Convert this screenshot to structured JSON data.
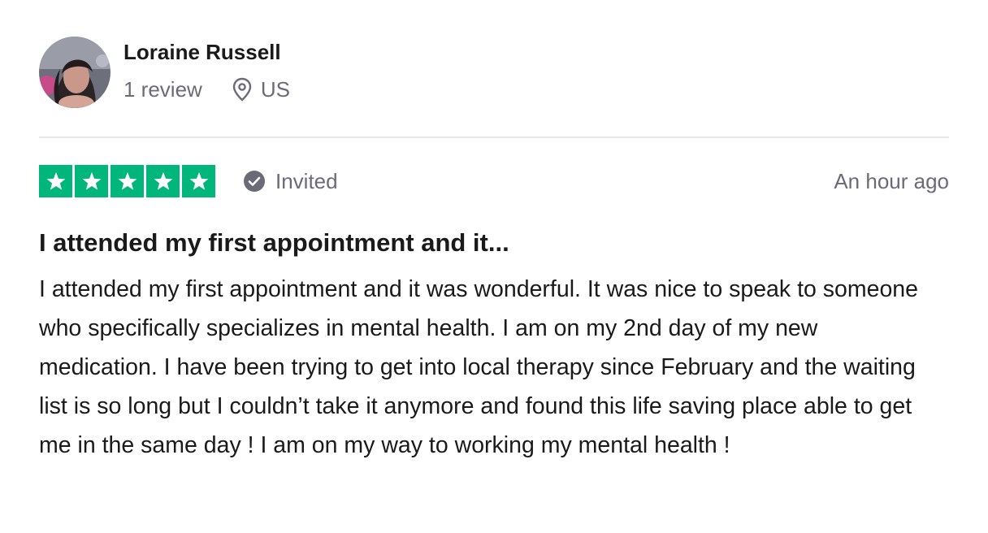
{
  "consumer": {
    "name": "Loraine Russell",
    "review_count": "1 review",
    "location": "US",
    "avatar_icon": "avatar-photo"
  },
  "review": {
    "rating": 5,
    "rating_max": 5,
    "star_color": "#00b67a",
    "invited_label": "Invited",
    "invited_icon": "check-circle-icon",
    "date": "An hour ago",
    "title": "I attended my first appointment and it...",
    "body": "I attended my first appointment and it was wonderful. It was nice to speak to someone who specifically specializes in mental health. I am on my 2nd day of my new medication. I have been trying to get into local therapy since February and the waiting list is so long but I couldn’t take it anymore and found this life saving place able to get me in the same day ! I am on my way to working my mental health !"
  }
}
